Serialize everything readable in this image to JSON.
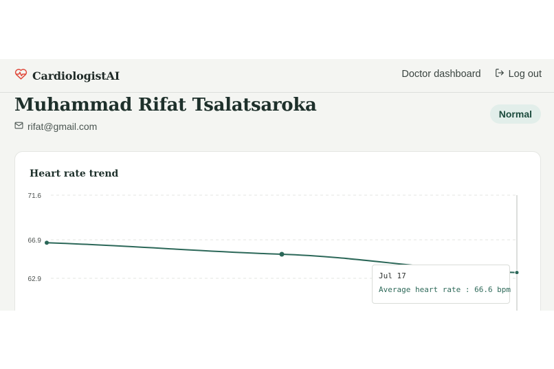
{
  "app": {
    "brand_name": "CardiologistAI"
  },
  "nav": {
    "doctor_dashboard": "Doctor dashboard",
    "logout": "Log out"
  },
  "patient": {
    "name": "Muhammad Rifat Tsalatsaroka",
    "email": "rifat@gmail.com",
    "status": "Normal"
  },
  "colors": {
    "brand_red": "#e04a3c",
    "accent": "#2b6758",
    "badge_bg": "#e2eeea",
    "page_bg": "#f4f5f2"
  },
  "icons": {
    "brand": "heart-pulse-icon",
    "email": "mail-icon",
    "logout": "log-out-icon"
  },
  "card": {
    "title": "Heart rate trend"
  },
  "tooltip": {
    "date": "Jul 17",
    "label": "Average heart rate",
    "value": "66.6",
    "unit": "bpm",
    "text": "Average heart rate : 66.6 bpm"
  },
  "chart_data": {
    "type": "line",
    "title": "Heart rate trend",
    "y_ticks": [
      "71.6",
      "66.9",
      "62.9"
    ],
    "ylim": [
      62.9,
      71.6
    ],
    "grid": true,
    "x": [
      "",
      "",
      "Jul 17"
    ],
    "series": [
      {
        "values": [
          66.6,
          65.4,
          63.5
        ]
      }
    ]
  }
}
